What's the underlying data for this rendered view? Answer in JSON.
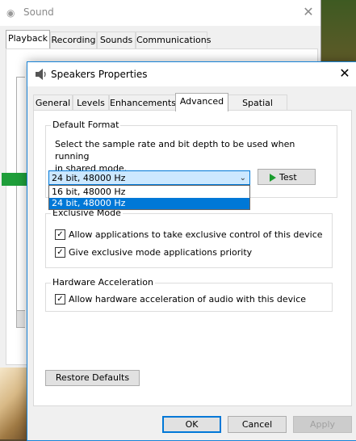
{
  "sound_window": {
    "title": "Sound",
    "close_glyph": "✕",
    "tabs": [
      {
        "label": "Playback"
      },
      {
        "label": "Recording"
      },
      {
        "label": "Sounds"
      },
      {
        "label": "Communications"
      }
    ]
  },
  "dialog": {
    "title": "Speakers Properties",
    "close_glyph": "✕",
    "tabs": [
      {
        "label": "General"
      },
      {
        "label": "Levels"
      },
      {
        "label": "Enhancements"
      },
      {
        "label": "Advanced"
      },
      {
        "label": "Spatial sound"
      }
    ],
    "default_format": {
      "label": "Default Format",
      "description_line1": "Select the sample rate and bit depth to be used when running",
      "description_line2": "in shared mode.",
      "selected_value": "24 bit, 48000 Hz",
      "options": [
        "16 bit, 48000 Hz",
        "24 bit, 48000 Hz"
      ],
      "test_label": "Test"
    },
    "exclusive_mode": {
      "label": "Exclusive Mode",
      "allow_exclusive": "Allow applications to take exclusive control of this device",
      "priority": "Give exclusive mode applications priority"
    },
    "hardware_acceleration": {
      "label": "Hardware Acceleration",
      "allow_hw": "Allow hardware acceleration of audio with this device"
    },
    "restore_label": "Restore Defaults",
    "ok_label": "OK",
    "cancel_label": "Cancel",
    "apply_label": "Apply",
    "check_glyph": "✓"
  },
  "colors": {
    "accent": "#0078d7",
    "arrow_green": "#1f9e3a"
  }
}
